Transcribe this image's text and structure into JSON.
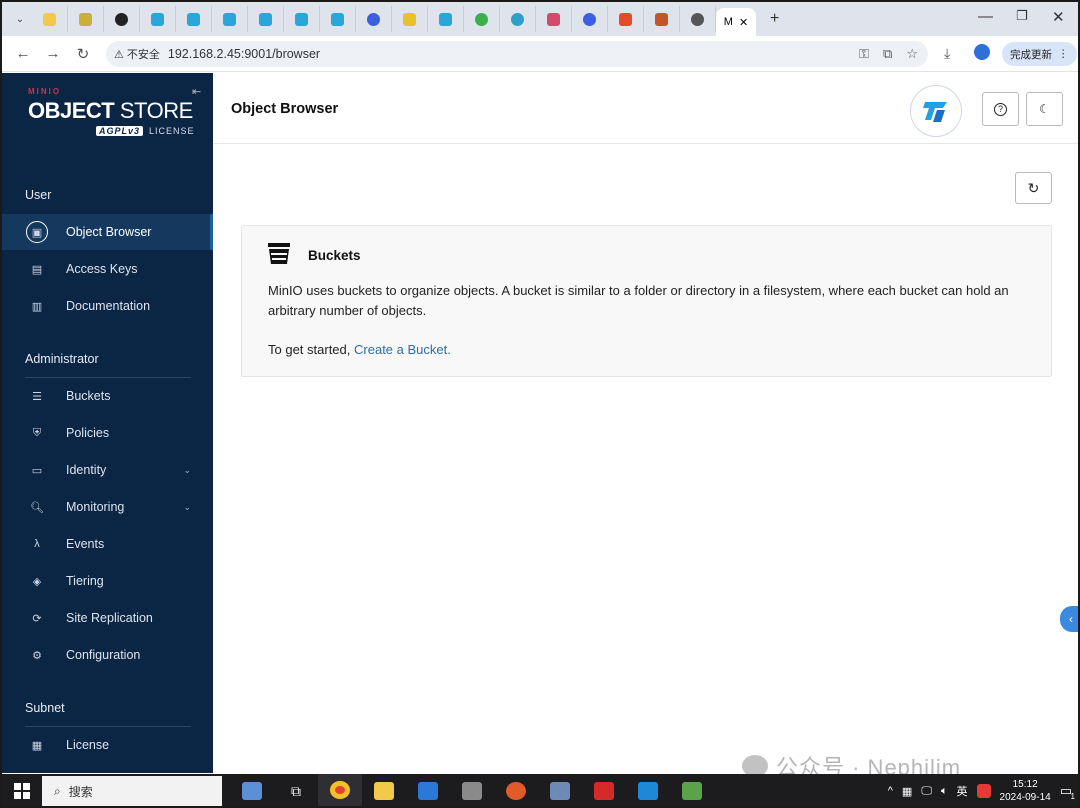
{
  "browser": {
    "insecure_label": "不安全",
    "url": "192.168.2.45:9001/browser",
    "update_label": "完成更新",
    "active_tab_label": "M"
  },
  "sidebar": {
    "brand_minio": "MINIO",
    "brand_object": "OBJECT",
    "brand_store": "STORE",
    "brand_agpl": "AGPLv3",
    "brand_license": "LICENSE",
    "sections": {
      "user": "User",
      "administrator": "Administrator",
      "subnet": "Subnet"
    },
    "user_items": [
      {
        "label": "Object Browser",
        "icon": "object-browser-icon"
      },
      {
        "label": "Access Keys",
        "icon": "access-keys-icon"
      },
      {
        "label": "Documentation",
        "icon": "documentation-icon"
      }
    ],
    "admin_items": [
      {
        "label": "Buckets",
        "icon": "buckets-icon"
      },
      {
        "label": "Policies",
        "icon": "policies-icon"
      },
      {
        "label": "Identity",
        "icon": "identity-icon"
      },
      {
        "label": "Monitoring",
        "icon": "monitoring-icon"
      },
      {
        "label": "Events",
        "icon": "events-icon"
      },
      {
        "label": "Tiering",
        "icon": "tiering-icon"
      },
      {
        "label": "Site Replication",
        "icon": "site-replication-icon"
      },
      {
        "label": "Configuration",
        "icon": "configuration-icon"
      }
    ],
    "subnet_items": [
      {
        "label": "License",
        "icon": "license-icon"
      }
    ]
  },
  "main": {
    "page_title": "Object Browser",
    "card": {
      "title": "Buckets",
      "description": "MinIO uses buckets to organize objects. A bucket is similar to a folder or directory in a filesystem, where each bucket can hold an arbitrary number of objects.",
      "start_text": "To get started,",
      "link_text": "Create a Bucket."
    }
  },
  "watermark": {
    "text": "公众号 · Nephilim"
  },
  "taskbar": {
    "search_label": "搜索",
    "ime": "英",
    "time": "15:12",
    "date": "2024-09-14",
    "notification_count": "1"
  },
  "colors": {
    "sidebar_bg": "#0b2545",
    "active_item_bg": "#15385f",
    "link": "#2d6ea5",
    "brand_red": "#c6364a"
  }
}
